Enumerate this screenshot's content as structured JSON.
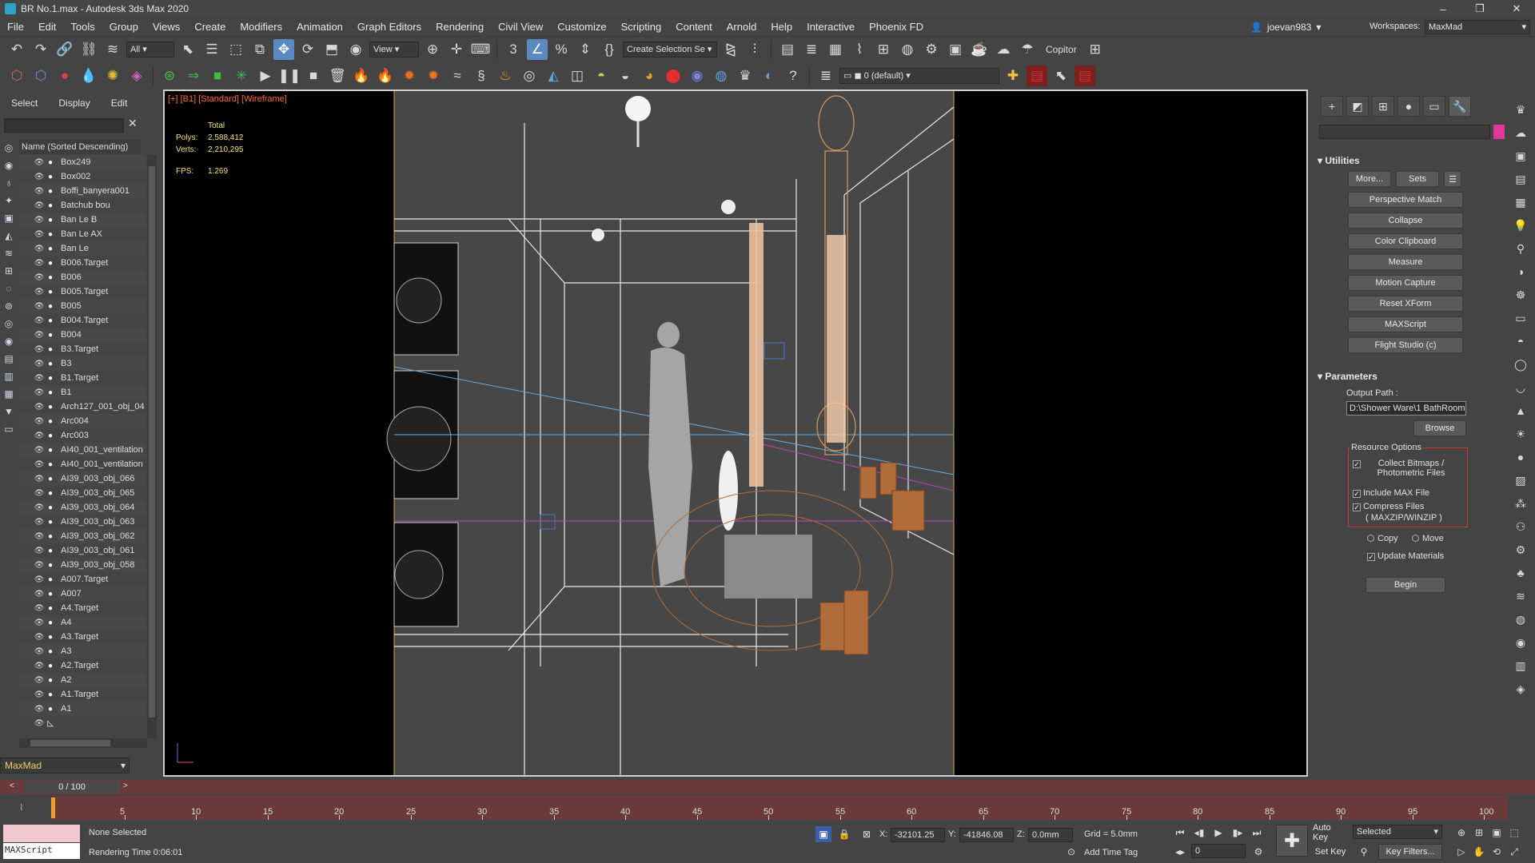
{
  "window": {
    "title": "BR No.1.max - Autodesk 3ds Max 2020",
    "controls": [
      "–",
      "❐",
      "✕"
    ]
  },
  "menu": {
    "items": [
      "File",
      "Edit",
      "Tools",
      "Group",
      "Views",
      "Create",
      "Modifiers",
      "Animation",
      "Graph Editors",
      "Rendering",
      "Civil View",
      "Customize",
      "Scripting",
      "Content",
      "Arnold",
      "Help",
      "Interactive",
      "Phoenix FD"
    ],
    "user": "joevan983",
    "workspaces_label": "Workspaces:",
    "workspace_value": "MaxMad"
  },
  "toolbar": {
    "filter_value": "All",
    "coord_system": "View",
    "selection_set": "Create Selection Se",
    "copitor": "Copitor",
    "layer_value": "0 (default)"
  },
  "explorer": {
    "tabs": [
      "Select",
      "Display",
      "Edit"
    ],
    "column_header": "Name (Sorted Descending)",
    "items": [
      "Box249",
      "Box002",
      "Boffi_banyera001",
      "Batchub bou",
      "Ban Le B",
      "Ban Le AX",
      "Ban Le",
      "B006.Target",
      "B006",
      "B005.Target",
      "B005",
      "B004.Target",
      "B004",
      "B3.Target",
      "B3",
      "B1.Target",
      "B1",
      "Arch127_001_obj_04",
      "Arc004",
      "Arc003",
      "AI40_001_ventilation",
      "AI40_001_ventilation",
      "AI39_003_obj_066",
      "AI39_003_obj_065",
      "AI39_003_obj_064",
      "AI39_003_obj_063",
      "AI39_003_obj_062",
      "AI39_003_obj_061",
      "AI39_003_obj_058",
      "A007.Target",
      "A007",
      "A4.Target",
      "A4",
      "A3.Target",
      "A3",
      "A2.Target",
      "A2",
      "A1.Target",
      "A1"
    ],
    "layer_name": "MaxMad"
  },
  "viewport": {
    "label": "[+] [B1] [Standard] [Wireframe]",
    "stats_total": "Total",
    "polys_label": "Polys:",
    "polys_value": "2,588,412",
    "verts_label": "Verts:",
    "verts_value": "2,210,295",
    "fps_label": "FPS:",
    "fps_value": "1.269"
  },
  "command_panel": {
    "utilities_title": "Utilities",
    "more_button": "More...",
    "sets_button": "Sets",
    "utility_buttons": [
      "Perspective Match",
      "Collapse",
      "Color Clipboard",
      "Measure",
      "Motion Capture",
      "Reset XForm",
      "MAXScript",
      "Flight Studio (c)"
    ],
    "parameters_title": "Parameters",
    "output_path_label": "Output Path :",
    "output_path_value": "D:\\Shower Ware\\1 BathRoom",
    "browse_button": "Browse",
    "resource_options_label": "Resource Options",
    "collect_bitmaps": "Collect Bitmaps / Photometric Files",
    "include_max": "Include MAX File",
    "compress_files": "Compress Files",
    "compress_sub": "( MAXZIP/WINZIP )",
    "copy_label": "Copy",
    "move_label": "Move",
    "update_materials": "Update Materials",
    "begin_button": "Begin"
  },
  "timeline": {
    "frame_display": "0 / 100",
    "ticks": [
      "5",
      "10",
      "15",
      "20",
      "25",
      "30",
      "35",
      "40",
      "45",
      "50",
      "55",
      "60",
      "65",
      "70",
      "75",
      "80",
      "85",
      "90",
      "95",
      "100"
    ]
  },
  "status": {
    "maxscript_label": "MAXScript",
    "selection": "None Selected",
    "render_time": "Rendering Time  0:06:01",
    "x_label": "X:",
    "x_value": "-32101.25",
    "y_label": "Y:",
    "y_value": "-41846.08",
    "z_label": "Z:",
    "z_value": "0.0mm",
    "grid": "Grid = 5.0mm",
    "add_time_tag": "Add Time Tag",
    "auto_key": "Auto Key",
    "selected_value": "Selected",
    "set_key": "Set Key",
    "key_filters": "Key Filters...",
    "current_frame": "0"
  }
}
